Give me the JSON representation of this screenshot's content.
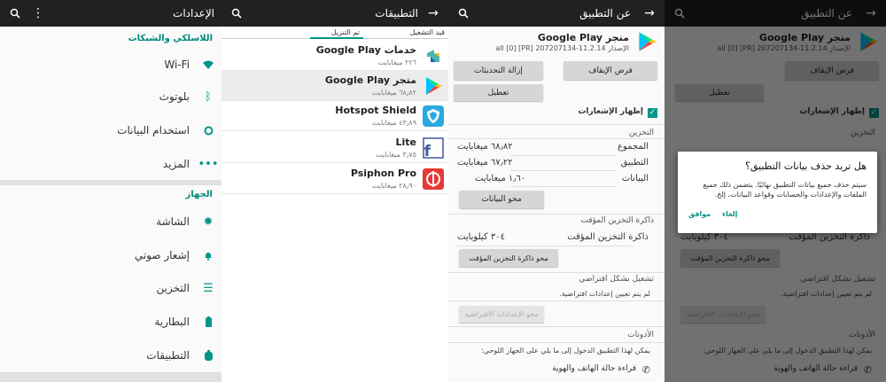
{
  "settings": {
    "title": "الإعدادات",
    "section_wireless": "اللاسلكي والشبكات",
    "section_device": "الجهاز",
    "items": [
      {
        "label": "Wi-Fi",
        "icon": "wifi-icon"
      },
      {
        "label": "بلوتوث",
        "icon": "bluetooth-icon"
      },
      {
        "label": "استخدام البيانات",
        "icon": "data-usage-icon"
      },
      {
        "label": "المزيد",
        "icon": "more-icon"
      },
      {
        "label": "الشاشة",
        "icon": "display-icon"
      },
      {
        "label": "إشعار صوتي",
        "icon": "bell-icon"
      },
      {
        "label": "التخزين",
        "icon": "storage-icon"
      },
      {
        "label": "البطارية",
        "icon": "battery-icon"
      },
      {
        "label": "التطبيقات",
        "icon": "apps-icon"
      }
    ]
  },
  "apps": {
    "title": "التطبيقات",
    "tab_running": "قيد التشغيل",
    "tab_downloaded": "تم التنزيل",
    "list": [
      {
        "name": "خدمات Google Play",
        "size": "٢٢٦ ميغابايت",
        "icon": "play-services-icon"
      },
      {
        "name": "متجر Google Play",
        "size": "٦٨٫٨٢ ميغابايت",
        "icon": "play-store-icon"
      },
      {
        "name": "Hotspot Shield",
        "size": "٤٣٫٨٩ ميغابايت",
        "icon": "hotspot-shield-icon"
      },
      {
        "name": "Lite",
        "size": "٣٫٧٥ ميغابايت",
        "icon": "facebook-lite-icon"
      },
      {
        "name": "Psiphon Pro",
        "size": "٢٨٫٩٠ ميغابايت",
        "icon": "psiphon-icon"
      }
    ]
  },
  "appinfo": {
    "title": "عن التطبيق",
    "app_name": "متجر Google Play",
    "version": "الإصدار 11.2.14-207207134 [PR] [0] all",
    "force_stop": "فرض الإيقاف",
    "uninstall_updates": "إزالة التحديثات",
    "disable": "تعطيل",
    "show_notifications": "إظهار الإشعارات",
    "storage_header": "التخزين",
    "total_label": "المجموع",
    "total_value": "٦٨٫٨٢ ميغابايت",
    "app_label": "التطبيق",
    "app_value": "٦٧٫٢٢ ميغابايت",
    "data_label": "البيانات",
    "data_value": "١٫٦٠ ميغابايت",
    "clear_data": "محو البيانات",
    "cache_header": "ذاكرة التخزين المؤقت",
    "cache_label": "ذاكرة التخزين المؤقت",
    "cache_value": "٣٠٤ كيلوبايت",
    "clear_cache": "محو ذاكرة التخزين المؤقت",
    "launch_default_header": "تشغيل بشكل افتراضي",
    "no_defaults": "لم يتم تعيين إعدادات افتراضية.",
    "clear_defaults": "محو الإعدادات الافتراضية",
    "permissions_header": "الأذونات",
    "permissions_desc": "يمكن لهذا التطبيق الدخول إلى ما يلي على الجهاز اللوحي:",
    "permission_phone": "قراءة حالة الهاتف والهوية"
  },
  "dialog": {
    "title": "هل تريد حذف بيانات التطبيق؟",
    "body": "سيتم حذف جميع بيانات التطبيق نهائيًا. يتضمن ذلك جميع الملفات والإعدادات والحسابات وقواعد البيانات، إلخ.",
    "ok": "موافق",
    "cancel": "إلغاء"
  },
  "colors": {
    "accent": "#009688",
    "toolbar": "#212121"
  }
}
